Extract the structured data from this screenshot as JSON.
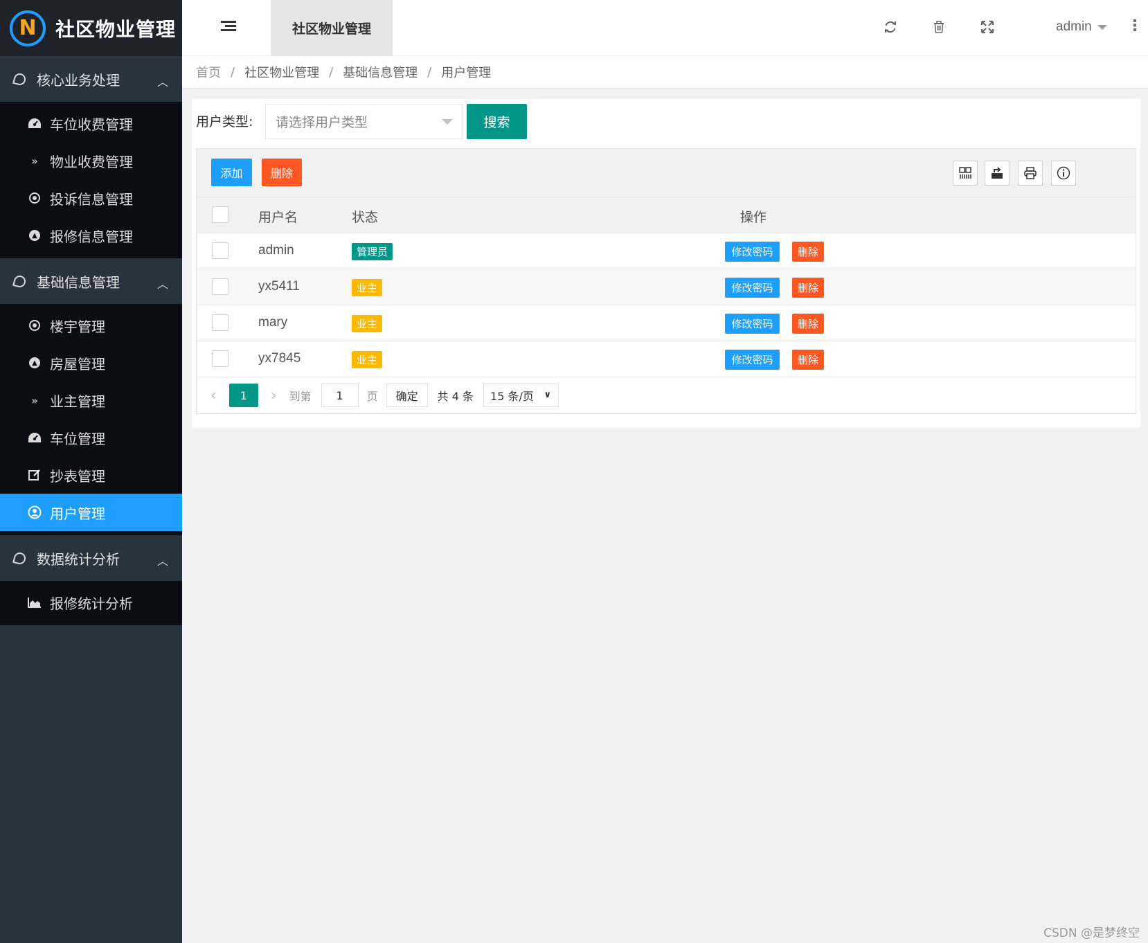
{
  "app": {
    "logo_letter": "N",
    "title": "社区物业管理"
  },
  "sidebar": {
    "groups": [
      {
        "label": "核心业务处理",
        "items": [
          {
            "label": "车位收费管理",
            "icon": "dashboard-icon"
          },
          {
            "label": "物业收费管理",
            "icon": "double-chevron-down-icon"
          },
          {
            "label": "投诉信息管理",
            "icon": "target-icon"
          },
          {
            "label": "报修信息管理",
            "icon": "up-circle-icon"
          }
        ]
      },
      {
        "label": "基础信息管理",
        "items": [
          {
            "label": "楼宇管理",
            "icon": "target-icon"
          },
          {
            "label": "房屋管理",
            "icon": "up-circle-icon"
          },
          {
            "label": "业主管理",
            "icon": "double-chevron-down-icon"
          },
          {
            "label": "车位管理",
            "icon": "dashboard-icon"
          },
          {
            "label": "抄表管理",
            "icon": "edit-icon"
          },
          {
            "label": "用户管理",
            "icon": "user-circle-icon",
            "active": true
          }
        ]
      },
      {
        "label": "数据统计分析",
        "items": [
          {
            "label": "报修统计分析",
            "icon": "area-chart-icon"
          }
        ]
      }
    ]
  },
  "header": {
    "tab_label": "社区物业管理",
    "user": "admin",
    "more": "⋮"
  },
  "breadcrumb": [
    "首页",
    "社区物业管理",
    "基础信息管理",
    "用户管理"
  ],
  "breadcrumb_sep": "/",
  "search": {
    "label": "用户类型:",
    "placeholder": "请选择用户类型",
    "button": "搜索"
  },
  "toolbar": {
    "add_label": "添加",
    "delete_label": "删除"
  },
  "table": {
    "columns": [
      "用户名",
      "状态",
      "操作"
    ],
    "rows": [
      {
        "username": "admin",
        "status": "管理员",
        "status_type": "admin"
      },
      {
        "username": "yx5411",
        "status": "业主",
        "status_type": "owner"
      },
      {
        "username": "mary",
        "status": "业主",
        "status_type": "owner"
      },
      {
        "username": "yx7845",
        "status": "业主",
        "status_type": "owner"
      }
    ],
    "row_actions": {
      "edit_password": "修改密码",
      "delete": "删除"
    }
  },
  "pager": {
    "prev": "‹",
    "next": "›",
    "current": "1",
    "goto_label": "到第",
    "goto_value": "1",
    "page_label": "页",
    "confirm": "确定",
    "total": "共 4 条",
    "limit": "15 条/页"
  },
  "colors": {
    "sidebar_bg": "#28333e",
    "active_blue": "#1e9fff",
    "teal": "#009688",
    "danger": "#ff5722",
    "warning": "#ffb800"
  },
  "watermark": "CSDN @是梦终空"
}
